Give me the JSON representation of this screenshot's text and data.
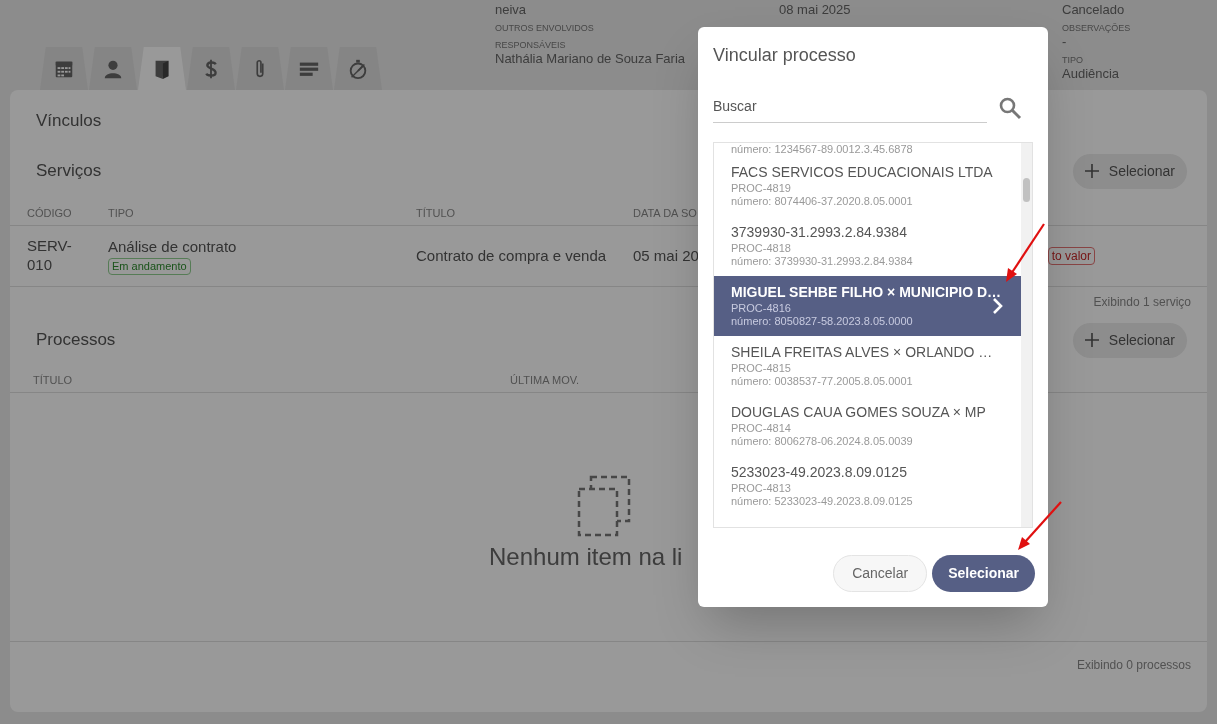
{
  "header": {
    "columns": [
      [
        {
          "kind": "value",
          "text": "neiva"
        },
        {
          "kind": "label",
          "text": "OUTROS ENVOLVIDOS"
        },
        {
          "kind": "label",
          "text": "RESPONSÁVEIS"
        },
        {
          "kind": "value",
          "text": "Nathália Mariano de Souza Faria"
        }
      ],
      [
        {
          "kind": "value",
          "text": "08 mai 2025"
        }
      ],
      [
        {
          "kind": "value",
          "text": "Cancelado"
        },
        {
          "kind": "label",
          "text": "OBSERVAÇÕES"
        },
        {
          "kind": "value",
          "text": "-"
        },
        {
          "kind": "label",
          "text": "TIPO"
        },
        {
          "kind": "value",
          "text": "Audiência"
        }
      ]
    ]
  },
  "tabs": [
    {
      "kind": "calendar",
      "selected": false
    },
    {
      "kind": "person",
      "selected": false
    },
    {
      "kind": "document",
      "selected": true
    },
    {
      "kind": "dollar",
      "selected": false
    },
    {
      "kind": "paperclip",
      "selected": false
    },
    {
      "kind": "lines",
      "selected": false
    },
    {
      "kind": "stopwatch",
      "selected": false
    }
  ],
  "panel": {
    "title": "Vínculos",
    "services": {
      "title": "Serviços",
      "select_button": "Selecionar",
      "columns": [
        "CÓDIGO",
        "TIPO",
        "TÍTULO",
        "DATA DA SO"
      ],
      "rows": [
        {
          "code": "SERV-010",
          "type": "Análise de contrato",
          "status": "Em andamento",
          "title": "Contrato de compra e venda",
          "date": "05 mai 20",
          "tag": "to valor"
        }
      ],
      "footer": "Exibindo 1 serviço"
    },
    "processes": {
      "title": "Processos",
      "select_button": "Selecionar",
      "columns": [
        "TÍTULO",
        "ÚLTIMA MOV."
      ],
      "empty_message": "Nenhum item na li",
      "footer": "Exibindo 0 processos"
    }
  },
  "dialog": {
    "title": "Vincular processo",
    "search": {
      "placeholder": "Buscar"
    },
    "items": [
      {
        "kind": "partial",
        "number": "número: 1234567-89.0012.3.45.6878",
        "selected": false
      },
      {
        "kind": "full",
        "title": "FACS SERVICOS EDUCACIONAIS LTDA",
        "code": "PROC-4819",
        "number": "número: 8074406-37.2020.8.05.0001",
        "selected": false
      },
      {
        "kind": "full",
        "title": "3739930-31.2993.2.84.9384",
        "code": "PROC-4818",
        "number": "número: 3739930-31.2993.2.84.9384",
        "selected": false
      },
      {
        "kind": "full",
        "title": "MIGUEL SEHBE FILHO × MUNICIPIO D…",
        "code": "PROC-4816",
        "number": "número: 8050827-58.2023.8.05.0000",
        "selected": true
      },
      {
        "kind": "full",
        "title": "SHEILA FREITAS ALVES × ORLANDO …",
        "code": "PROC-4815",
        "number": "número: 0038537-77.2005.8.05.0001",
        "selected": false
      },
      {
        "kind": "full",
        "title": "DOUGLAS CAUA GOMES SOUZA × MP",
        "code": "PROC-4814",
        "number": "número: 8006278-06.2024.8.05.0039",
        "selected": false
      },
      {
        "kind": "full",
        "title": "5233023-49.2023.8.09.0125",
        "code": "PROC-4813",
        "number": "número: 5233023-49.2023.8.09.0125",
        "selected": false
      }
    ],
    "buttons": [
      {
        "kind": "secondary",
        "label": "Cancelar"
      },
      {
        "kind": "primary",
        "label": "Selecionar"
      }
    ]
  }
}
